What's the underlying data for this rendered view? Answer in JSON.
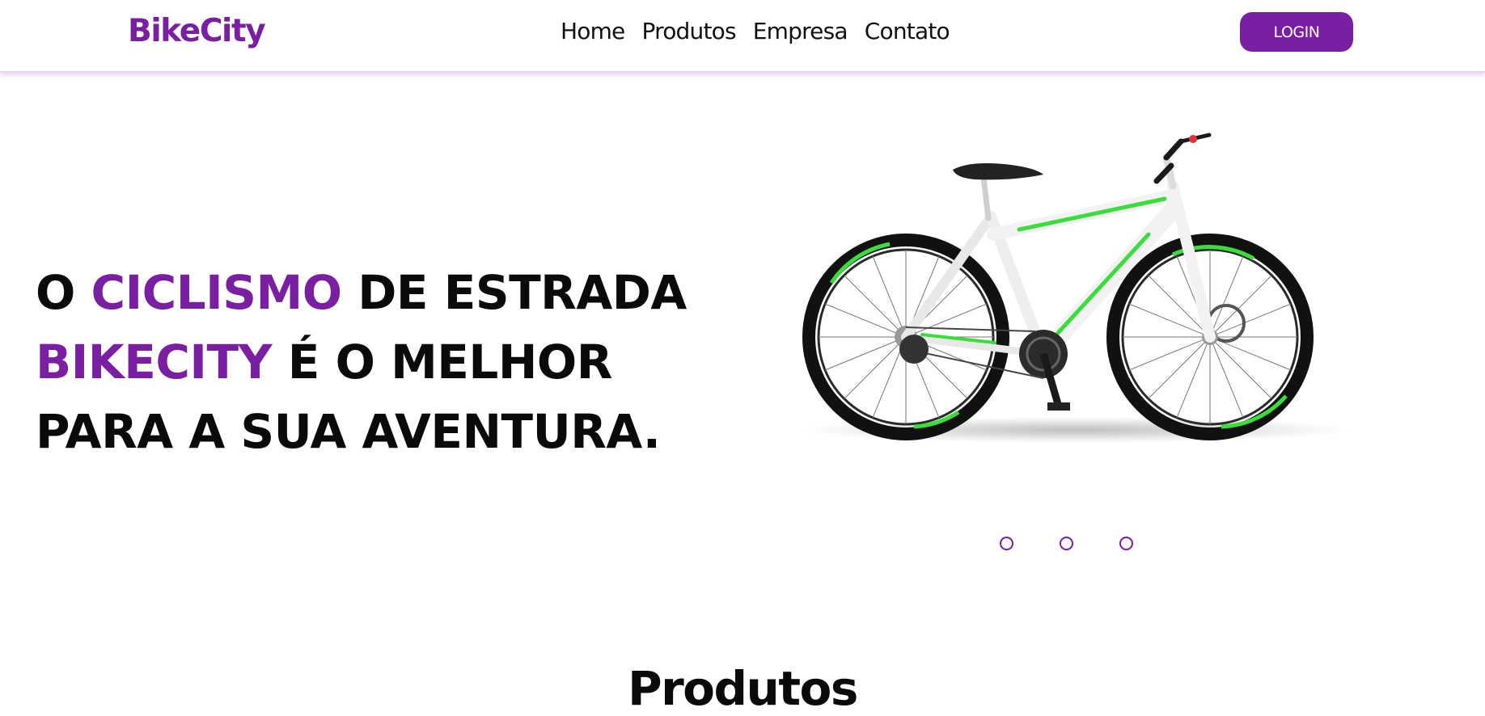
{
  "header": {
    "logo": "BikeCity",
    "nav": [
      "Home",
      "Produtos",
      "Empresa",
      "Contato"
    ],
    "login_label": "LOGIN"
  },
  "hero": {
    "line1": {
      "w1": "O",
      "w2": "CICLISMO",
      "w3": "DE ESTRADA"
    },
    "line2": {
      "w1": "BIKECITY",
      "w2": "É O MELHOR"
    },
    "line3": "PARA A SUA AVENTURA.",
    "image_alt": "Bicicleta branca com detalhes verdes",
    "carousel_count": 3
  },
  "section": {
    "title": "Produtos"
  },
  "colors": {
    "accent": "#7b1fa2",
    "bike_green": "#3ddc3d",
    "tire": "#111111"
  }
}
